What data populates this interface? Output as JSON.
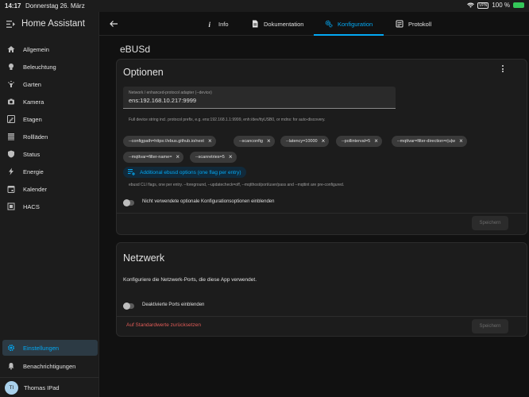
{
  "status": {
    "time": "14:17",
    "date": "Donnerstag 26. März",
    "vpn": "VPN",
    "battery": "100 %"
  },
  "sidebar": {
    "title": "Home Assistant",
    "items": [
      {
        "label": "Allgemein",
        "icon": "home-icon"
      },
      {
        "label": "Beleuchtung",
        "icon": "lightbulb-icon"
      },
      {
        "label": "Garten",
        "icon": "sprinkler-icon"
      },
      {
        "label": "Kamera",
        "icon": "camera-icon"
      },
      {
        "label": "Etagen",
        "icon": "stairs-icon"
      },
      {
        "label": "Rollläden",
        "icon": "shutter-icon"
      },
      {
        "label": "Status",
        "icon": "shield-icon"
      },
      {
        "label": "Energie",
        "icon": "lightning-icon"
      },
      {
        "label": "Kalender",
        "icon": "calendar-icon"
      },
      {
        "label": "HACS",
        "icon": "hacs-icon"
      }
    ],
    "settings": "Einstellungen",
    "notifications": "Benachrichtigungen",
    "user": {
      "initials": "TI",
      "name": "Thomas IPad"
    }
  },
  "tabs": [
    {
      "label": "Info",
      "icon": "info-icon"
    },
    {
      "label": "Dokumentation",
      "icon": "document-icon"
    },
    {
      "label": "Konfiguration",
      "icon": "cogs-icon"
    },
    {
      "label": "Protokoll",
      "icon": "log-icon"
    }
  ],
  "page_title": "eBUSd",
  "options": {
    "title": "Optionen",
    "field_label": "Network / enhanced-protocol adapter (--device)",
    "field_value": "ens:192.168.10.217:9999",
    "field_helper": "Full device string incl. protocol prefix, e.g. ens:192.168.1.1:9999, enh:/dev/ttyUSB0, or mdns: for auto-discovery.",
    "chips": [
      "--configpath=https://ebus.github.io/next",
      "--scanconfig",
      "--latency=10000",
      "--pollinterval=5",
      "--mqttvar=filter-direction=r|u|w",
      "--mqttvar=filter-name=",
      "--scanretries=5"
    ],
    "add_flag": "Additional ebusd options (one flag per entry)",
    "flags_helper": "ebusd CLI flags, one per entry. --foreground, --updatecheck=off, --mqtthost/port/user/pass and --mqttint are pre-configured.",
    "toggle_label": "Nicht verwendete optionale Konfigurationsoptionen einblenden",
    "save": "Speichern"
  },
  "network": {
    "title": "Netzwerk",
    "description": "Konfiguriere die Netzwerk-Ports, die diese App verwendet.",
    "toggle_label": "Deaktivierte Ports einblenden",
    "reset": "Auf Standardwerte zurücksetzen",
    "save": "Speichern"
  },
  "colors": {
    "accent": "#03a9f4",
    "danger": "#e05b57",
    "card": "#1c1c1c",
    "background": "#111111"
  }
}
